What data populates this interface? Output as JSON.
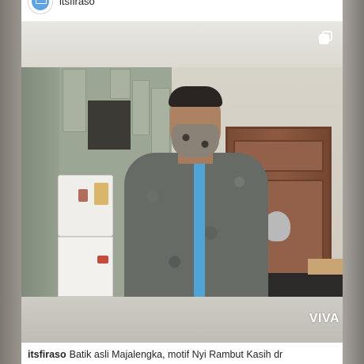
{
  "header": {
    "username": "itsfiraso",
    "avatar_icon": "profile-avatar-icon"
  },
  "post": {
    "media_type_icon": "multiple-posts-icon",
    "watermark": "VIVA"
  },
  "caption": {
    "username": "itsfiraso",
    "text": "Batik asli Majalengka, motif Nyi Rambut Kasih dr"
  },
  "colors": {
    "background": "#8c8782",
    "card": "#ffffff",
    "text": "#262626",
    "shirt_accent": "#4fa3d6"
  }
}
